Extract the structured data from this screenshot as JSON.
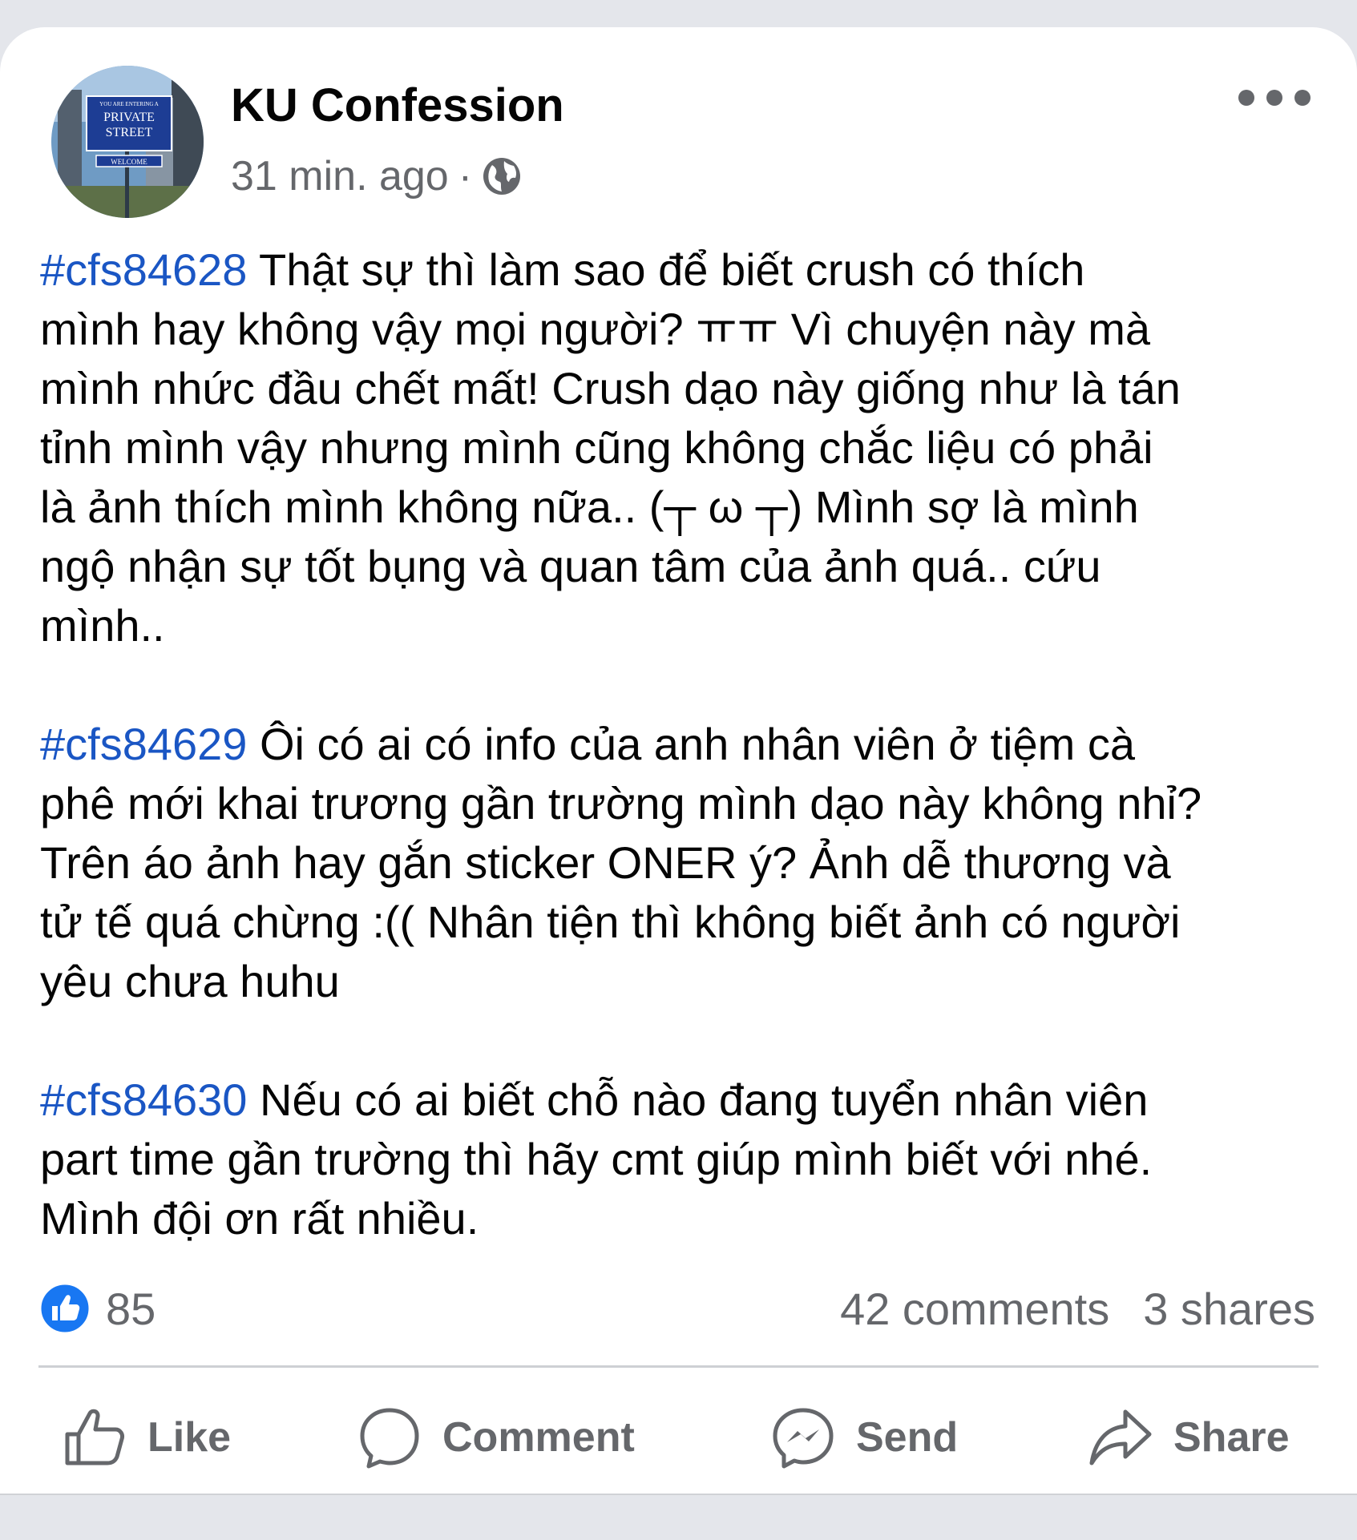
{
  "post": {
    "page_name": "KU Confession",
    "time": "31 min. ago",
    "separator": "·",
    "avatar_sign": {
      "top_text": "YOU ARE ENTERING A",
      "line1": "PRIVATE",
      "line2": "STREET",
      "bottom_text": "WELCOME"
    },
    "paragraphs": [
      {
        "hashtag": "#cfs84628",
        "first_line": " Thật sự thì làm sao để biết crush có thích",
        "lines": [
          "mình hay không vậy mọi người? ㅠㅠ Vì chuyện này mà",
          "mình nhức đầu chết mất! Crush dạo này giống như là tán",
          "tỉnh mình vậy nhưng mình cũng không chắc liệu có phải",
          "là ảnh thích mình không nữa.. (┬ ω ┬) Mình sợ là mình",
          "ngộ nhận sự tốt bụng và quan tâm của ảnh quá.. cứu",
          "mình.."
        ]
      },
      {
        "hashtag": "#cfs84629",
        "first_line": " Ôi có ai có info của anh nhân viên ở tiệm cà",
        "lines": [
          "phê mới khai trương gần trường mình dạo này không nhỉ?",
          "Trên áo ảnh hay gắn sticker ONER ý? Ảnh dễ thương và",
          "tử tế quá chừng :(( Nhân tiện thì không biết ảnh có người",
          "yêu chưa huhu"
        ]
      },
      {
        "hashtag": "#cfs84630",
        "first_line": " Nếu có ai biết chỗ nào đang tuyển nhân viên",
        "lines": [
          "part time gần trường thì hãy cmt giúp mình biết với nhé.",
          "Mình đội ơn rất nhiều."
        ]
      }
    ],
    "reactions_count": "85",
    "comments": "42 comments",
    "shares": "3 shares"
  },
  "actions": {
    "like": "Like",
    "comment": "Comment",
    "send": "Send",
    "share": "Share"
  },
  "colors": {
    "hashtag": "#1a56c4",
    "like_blue": "#1877f2",
    "muted": "#65676b",
    "text": "#050505"
  },
  "icons": [
    "globe-icon",
    "more-options-icon",
    "like-reaction-icon",
    "thumbs-up-icon",
    "comment-icon",
    "messenger-icon",
    "share-arrow-icon"
  ]
}
